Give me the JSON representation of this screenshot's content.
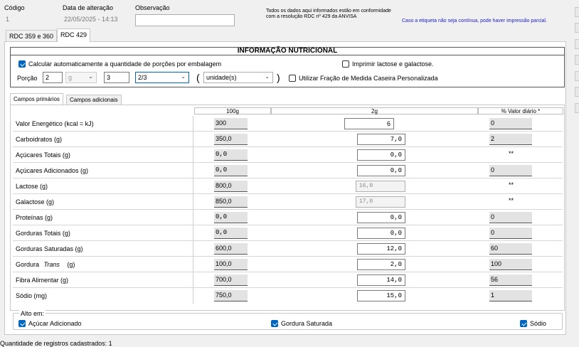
{
  "header": {
    "codigo_label": "Código",
    "codigo_value": "1",
    "data_label": "Data de alteração",
    "data_value": "22/05/2025 - 14:13",
    "obs_label": "Observação",
    "obs_value": "",
    "notice": "Todos os dados aqui informados estão em conformidade com a resolução RDC nº 429 da ANVISA",
    "warning": "Caso a etiqueta não seja contínua, pode haver impressão parcial."
  },
  "tabs": [
    "RDC 359 e 360",
    "RDC 429"
  ],
  "title": "INFORMAÇÃO NUTRICIONAL",
  "options": {
    "auto_calc": "Calcular automaticamente a quantidade de porções por embalagem",
    "print_lactose": "Imprimir lactose e galactose.",
    "fraction": "Utilizar Fração de Medida Caseira Personalizada",
    "porcao_label": "Porção",
    "porcao_value": "2",
    "unit": "g",
    "qty": "3",
    "fraction_value": "2/3",
    "medida": "unidade(s)",
    "paren_open": "(",
    "paren_close": ")"
  },
  "subtabs": [
    "Campos primários",
    "Campos adicionais"
  ],
  "columns": [
    "100g",
    "2g",
    "% Valor diário *"
  ],
  "rows": [
    {
      "name": "Valor Energético (kcal = kJ)",
      "v100": "300",
      "v2": "6",
      "vd": "0"
    },
    {
      "name": "Carboidratos (g)",
      "v100": "350,0",
      "v2": "7,0",
      "vd": "2"
    },
    {
      "name": "Açúcares Totais (g)",
      "v100": "0,0",
      "v2": "0,0",
      "vd": "**"
    },
    {
      "name": "Açúcares Adicionados (g)",
      "v100": "0,0",
      "v2": "0,0",
      "vd": "0"
    },
    {
      "name": "Lactose (g)",
      "v100": "800,0",
      "v2": "16,0",
      "vd": "**"
    },
    {
      "name": "Galactose (g)",
      "v100": "850,0",
      "v2": "17,0",
      "vd": "**"
    },
    {
      "name": "Proteínas (g)",
      "v100": "0,0",
      "v2": "0,0",
      "vd": "0"
    },
    {
      "name": "Gorduras Totais (g)",
      "v100": "0,0",
      "v2": "0,0",
      "vd": "0"
    },
    {
      "name": "Gorduras Saturadas (g)",
      "v100": "600,0",
      "v2": "12,0",
      "vd": "60"
    },
    {
      "name": "Gordura",
      "name_italic": "Trans",
      "name_unit": "(g)",
      "v100": "100,0",
      "v2": "2,0",
      "vd": "100"
    },
    {
      "name": "Fibra Alimentar (g)",
      "v100": "700,0",
      "v2": "14,0",
      "vd": "56"
    },
    {
      "name": "Sódio (mg)",
      "v100": "750,0",
      "v2": "15,0",
      "vd": "1"
    }
  ],
  "alto": {
    "legend": "Alto em:",
    "acucar": "Açúcar Adicionado",
    "gordura": "Gordura Saturada",
    "sodio": "Sódio"
  },
  "footer": "Quantidade de registros cadastrados: 1",
  "colors": {
    "accent": "#0067c0",
    "warning": "#1a1acc"
  }
}
